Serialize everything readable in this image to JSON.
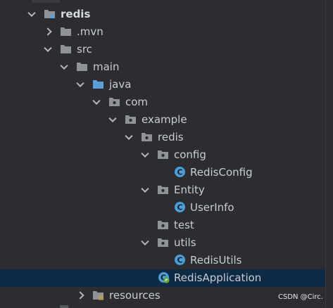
{
  "tree": {
    "items": [
      {
        "label": "redis",
        "type": "module",
        "level": 0,
        "expanded": true,
        "bold": true
      },
      {
        "label": ".mvn",
        "type": "folder",
        "level": 1,
        "expanded": false
      },
      {
        "label": "src",
        "type": "folder",
        "level": 1,
        "expanded": true
      },
      {
        "label": "main",
        "type": "folder",
        "level": 2,
        "expanded": true
      },
      {
        "label": "java",
        "type": "source-folder",
        "level": 3,
        "expanded": true
      },
      {
        "label": "com",
        "type": "package",
        "level": 4,
        "expanded": true
      },
      {
        "label": "example",
        "type": "package",
        "level": 5,
        "expanded": true
      },
      {
        "label": "redis",
        "type": "package",
        "level": 6,
        "expanded": true
      },
      {
        "label": "config",
        "type": "package",
        "level": 7,
        "expanded": true
      },
      {
        "label": "RedisConfig",
        "type": "class",
        "level": 8
      },
      {
        "label": "Entity",
        "type": "package",
        "level": 7,
        "expanded": true
      },
      {
        "label": "UserInfo",
        "type": "class",
        "level": 8
      },
      {
        "label": "test",
        "type": "package",
        "level": 7
      },
      {
        "label": "utils",
        "type": "package",
        "level": 7,
        "expanded": true
      },
      {
        "label": "RedisUtils",
        "type": "class",
        "level": 8
      },
      {
        "label": "RedisApplication",
        "type": "spring-class",
        "level": 7,
        "selected": true
      },
      {
        "label": "resources",
        "type": "resources-folder",
        "level": 3,
        "expanded": false
      }
    ]
  },
  "watermark": "CSDN @Circ.",
  "colors": {
    "background": "#2b2d30",
    "selection": "#0f2a44",
    "text": "#c9ccd2",
    "folder": "#8f9297",
    "source_folder": "#5a9fd6",
    "class_icon": "#4b9ed8",
    "spring_leaf": "#6aaa3a"
  }
}
